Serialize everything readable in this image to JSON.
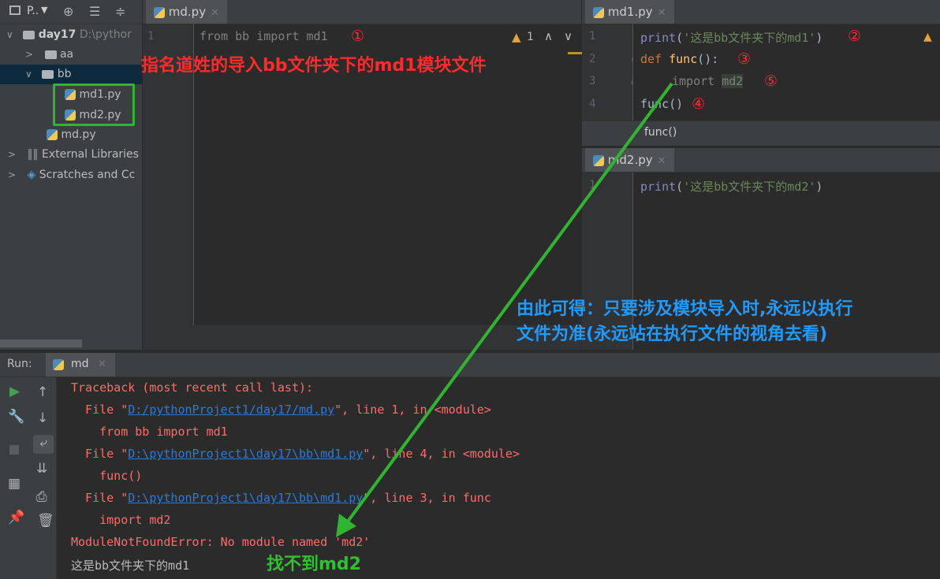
{
  "project": {
    "title": "P..",
    "tree": [
      {
        "label": "day17",
        "hint": "D:\\pythor"
      },
      {
        "label": "aa"
      },
      {
        "label": "bb"
      },
      {
        "label": "md1.py"
      },
      {
        "label": "md2.py"
      },
      {
        "label": "md.py"
      },
      {
        "label": "External Libraries"
      },
      {
        "label": "Scratches and Cc"
      }
    ]
  },
  "editor_left": {
    "tab": "md.py",
    "line_numbers": [
      "1"
    ],
    "code": {
      "kw1": "from",
      "mod": " bb ",
      "kw2": "import",
      "name": " md1"
    },
    "marker": "①",
    "warning_count": "1"
  },
  "editor_md1": {
    "tab": "md1.py",
    "line_numbers": [
      "1",
      "2",
      "3",
      "4"
    ],
    "lines": {
      "l1_fn": "print",
      "l1_open": "(",
      "l1_str": "'这是bb文件夹下的md1'",
      "l1_close": ")",
      "l2_kw": "def",
      "l2_fn": "func",
      "l2_rest": "():",
      "l3_kw": "import",
      "l3_name": "md2",
      "l4": "func()"
    },
    "markers": [
      "②",
      "③",
      "⑤",
      "④"
    ],
    "breadcrumb": "func()"
  },
  "editor_md2": {
    "tab": "md2.py",
    "line_numbers": [
      "1"
    ],
    "lines": {
      "fn": "print",
      "open": "(",
      "str": "'这是bb文件夹下的md2'",
      "close": ")"
    }
  },
  "annotations": {
    "red": "指名道姓的导入bb文件夹下的md1模块文件",
    "blue_line1": "由此可得：只要涉及模块导入时,永远以执行",
    "blue_line2": "文件为准(永远站在执行文件的视角去看)",
    "green": "找不到md2"
  },
  "run": {
    "label": "Run:",
    "tab": "md",
    "console": {
      "l1": "Traceback (most recent call last):",
      "l2_pre": "  File \"",
      "l2_link": "D:/pythonProject1/day17/md.py",
      "l2_post": "\", line 1, in <module>",
      "l3": "    from bb import md1",
      "l4_pre": "  File \"",
      "l4_link": "D:\\pythonProject1\\day17\\bb\\md1.py",
      "l4_post": "\", line 4, in <module>",
      "l5": "    func()",
      "l6_pre": "  File \"",
      "l6_link": "D:\\pythonProject1\\day17\\bb\\md1.py",
      "l6_post": "\", line 3, in func",
      "l7": "    import md2",
      "l8": "ModuleNotFoundError: No module named 'md2'",
      "l9": "这是bb文件夹下的md1"
    }
  },
  "colors": {
    "annotation_red": "#ff2a2a",
    "annotation_blue": "#1e9bff",
    "annotation_green": "#30c030",
    "arrow_green": "#2fb52f"
  }
}
